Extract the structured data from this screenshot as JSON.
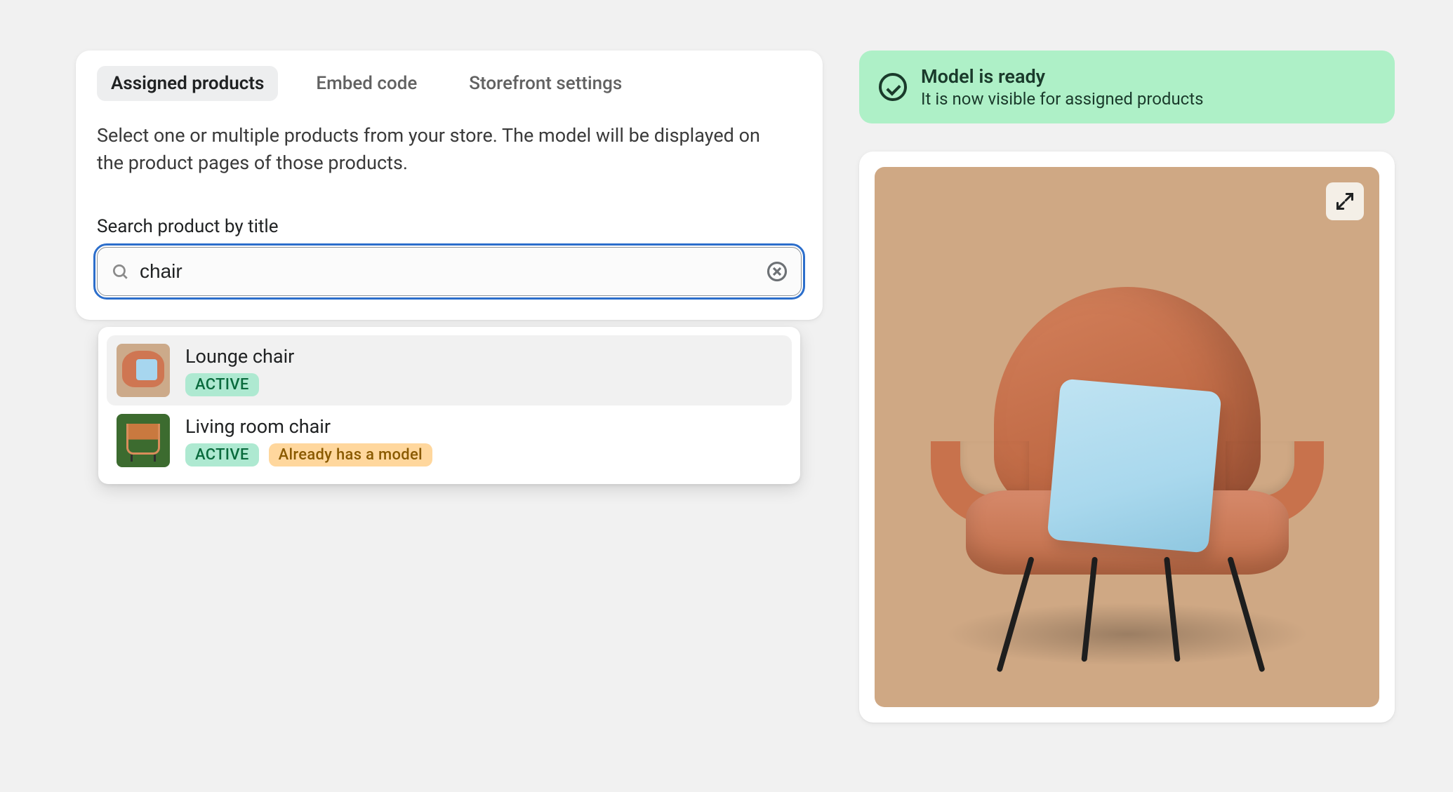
{
  "tabs": [
    {
      "label": "Assigned products",
      "active": true
    },
    {
      "label": "Embed code",
      "active": false
    },
    {
      "label": "Storefront settings",
      "active": false
    }
  ],
  "help_text": "Select one or multiple products from your store. The model will be displayed on the product pages of those products.",
  "search": {
    "label": "Search product by title",
    "value": "chair"
  },
  "results": [
    {
      "title": "Lounge chair",
      "status": "ACTIVE",
      "hovered": true,
      "thumb": "beige"
    },
    {
      "title": "Living room chair",
      "status": "ACTIVE",
      "extra_badge": "Already has a model",
      "hovered": false,
      "thumb": "green"
    }
  ],
  "banner": {
    "title": "Model is ready",
    "subtitle": "It is now visible for assigned products"
  },
  "colors": {
    "success_bg": "#aef0c7",
    "active_badge": "#aee9d1",
    "warn_badge": "#ffd79d",
    "focus_ring": "#2c6ecb",
    "preview_bg": "#cfa884"
  }
}
